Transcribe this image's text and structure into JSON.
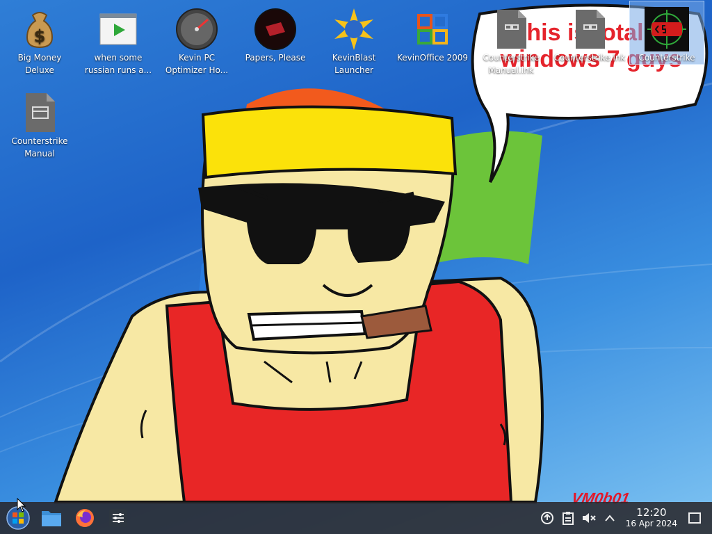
{
  "wallpaper": {
    "bubble_text": "this is totally windows 7 guys",
    "signature": "VM0b01"
  },
  "desktop": {
    "icons": [
      {
        "label": "Big Money Deluxe",
        "icon": "money-bag-icon"
      },
      {
        "label": "when some russian runs a...",
        "icon": "video-play-icon"
      },
      {
        "label": "Kevin PC Optimizer Ho...",
        "icon": "speedometer-icon"
      },
      {
        "label": "Papers, Please",
        "icon": "papers-please-icon"
      },
      {
        "label": "KevinBlast Launcher",
        "icon": "starburst-launcher-icon"
      },
      {
        "label": "KevinOffice 2009",
        "icon": "office-logo-icon"
      },
      {
        "label": "Counterstrike Manual.lnk",
        "icon": "link-file-icon"
      },
      {
        "label": "Counterstrike.lnk",
        "icon": "link-file-icon"
      },
      {
        "label": "Counterstrike",
        "icon": "counterstrike-icon"
      },
      {
        "label": "Counterstrike Manual",
        "icon": "document-file-icon"
      }
    ]
  },
  "taskbar": {
    "start_icon": "windows-start-icon",
    "pinned": [
      "file-manager-icon",
      "firefox-icon",
      "settings-sliders-icon"
    ],
    "tray": [
      "updates-icon",
      "clipboard-icon",
      "volume-muted-icon",
      "chevron-up-icon"
    ],
    "clock": {
      "time": "12:20",
      "date": "16 Apr 2024"
    },
    "show_desktop_icon": "show-desktop-icon"
  }
}
